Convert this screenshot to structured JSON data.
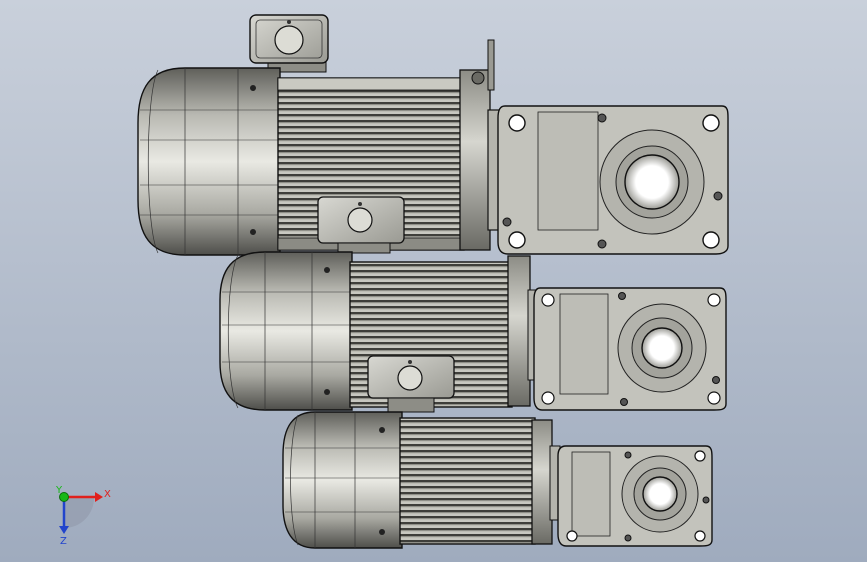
{
  "triad": {
    "x_label": "X",
    "y_label": "Y",
    "z_label": "Z",
    "x_color": "#e0201c",
    "y_color": "#18b818",
    "z_color": "#2244cc"
  },
  "colors": {
    "background_top": "#c9d0db",
    "background_bottom": "#9fabbe",
    "metal_light": "#e8e8e2",
    "metal_mid": "#a7a79f",
    "metal_dark": "#5a5a55",
    "edge": "#111111"
  },
  "models": [
    {
      "name": "gear-motor-large"
    },
    {
      "name": "gear-motor-medium"
    },
    {
      "name": "gear-motor-small"
    }
  ]
}
